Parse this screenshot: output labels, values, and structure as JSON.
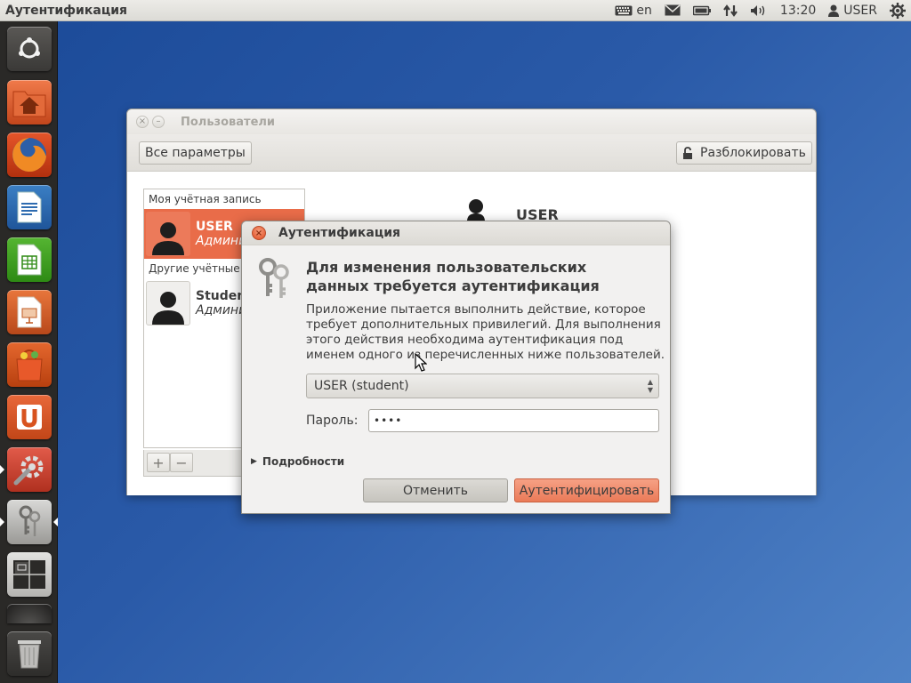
{
  "top_panel": {
    "app_title": "Аутентификация",
    "keyboard_layout": "en",
    "clock": "13:20",
    "user": "USER"
  },
  "users_window": {
    "title": "Пользователи",
    "close_glyph": "×",
    "minimize_glyph": "–",
    "all_settings_label": "Все параметры",
    "unlock_label": "Разблокировать",
    "my_account_header": "Моя учётная запись",
    "other_accounts_header": "Другие учётные за",
    "accounts": [
      {
        "name": "USER",
        "role": "Админи",
        "selected": true
      },
      {
        "name": "Studen",
        "role": "Админи",
        "selected": false
      }
    ],
    "add_glyph": "+",
    "remove_glyph": "−",
    "detail_name": "USER"
  },
  "auth_dialog": {
    "title": "Аутентификация",
    "close_glyph": "×",
    "heading_line1": "Для изменения пользовательских",
    "heading_line2": "данных требуется аутентификация",
    "message_lines": [
      "Приложение пытается выполнить действие, которое",
      "требует дополнительных привилегий. Для выполнения",
      "этого действия необходима аутентификация под",
      "именем одного из перечисленных ниже пользователей."
    ],
    "selected_user": "USER (student)",
    "password_label": "Пароль:",
    "password_value": "••••",
    "details_label": "Подробности",
    "cancel_label": "Отменить",
    "authenticate_label": "Аутентифицировать"
  },
  "colors": {
    "accent_orange": "#e96c49",
    "desktop_blue": "#2a5aa8",
    "launcher_bg": "#2a2927"
  },
  "launcher_icons": [
    "dash-home-icon",
    "home-folder-icon",
    "firefox-icon",
    "libreoffice-writer-icon",
    "libreoffice-calc-icon",
    "libreoffice-impress-icon",
    "software-center-icon",
    "ubuntu-one-icon",
    "system-settings-icon",
    "keys-icon",
    "workspace-switcher-icon",
    "trash-icon"
  ]
}
